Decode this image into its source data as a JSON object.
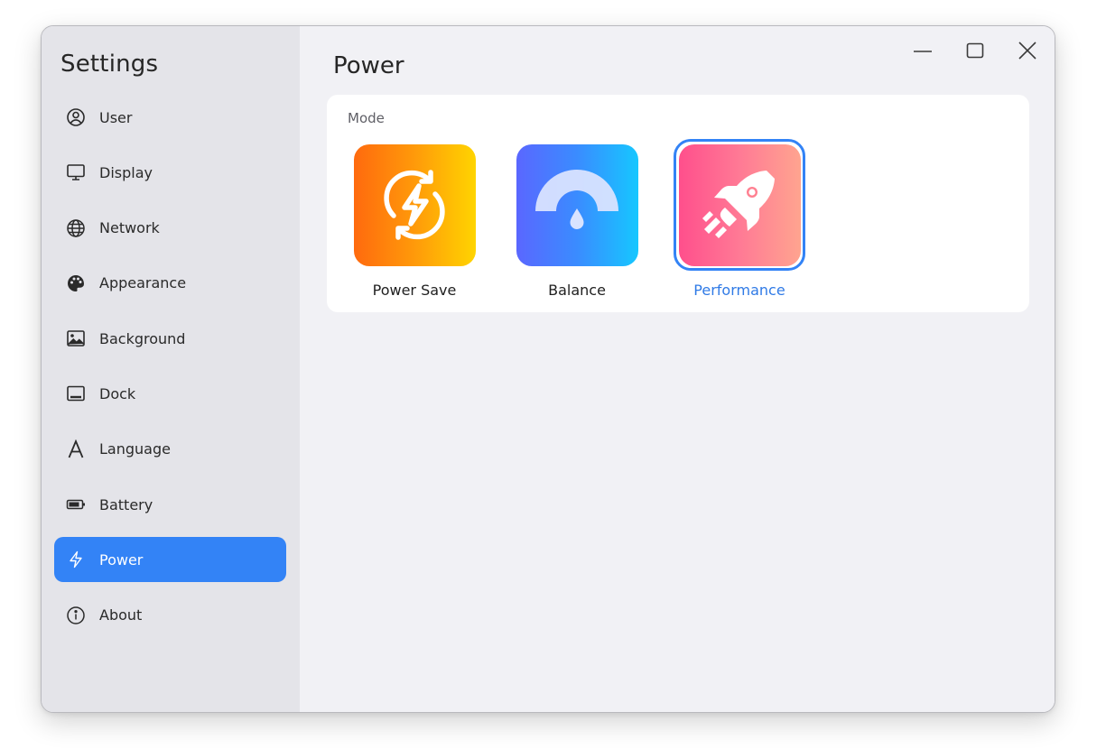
{
  "app": {
    "title": "Settings"
  },
  "sidebar": {
    "items": [
      {
        "label": "User",
        "icon": "user-icon",
        "active": false
      },
      {
        "label": "Display",
        "icon": "monitor-icon",
        "active": false
      },
      {
        "label": "Network",
        "icon": "globe-icon",
        "active": false
      },
      {
        "label": "Appearance",
        "icon": "palette-icon",
        "active": false
      },
      {
        "label": "Background",
        "icon": "image-icon",
        "active": false
      },
      {
        "label": "Dock",
        "icon": "dock-icon",
        "active": false
      },
      {
        "label": "Language",
        "icon": "language-icon",
        "active": false
      },
      {
        "label": "Battery",
        "icon": "battery-icon",
        "active": false
      },
      {
        "label": "Power",
        "icon": "bolt-icon",
        "active": true
      },
      {
        "label": "About",
        "icon": "info-icon",
        "active": false
      }
    ]
  },
  "main": {
    "title": "Power",
    "mode_section": {
      "label": "Mode",
      "options": [
        {
          "label": "Power Save",
          "icon": "power-save-icon",
          "selected": false
        },
        {
          "label": "Balance",
          "icon": "gauge-icon",
          "selected": false
        },
        {
          "label": "Performance",
          "icon": "rocket-icon",
          "selected": true
        }
      ]
    }
  },
  "window_controls": {
    "minimize": "minimize-icon",
    "maximize": "maximize-icon",
    "close": "close-icon"
  },
  "colors": {
    "accent": "#3383f6",
    "sidebar_bg": "#e4e4e9",
    "content_bg": "#f1f1f5"
  }
}
